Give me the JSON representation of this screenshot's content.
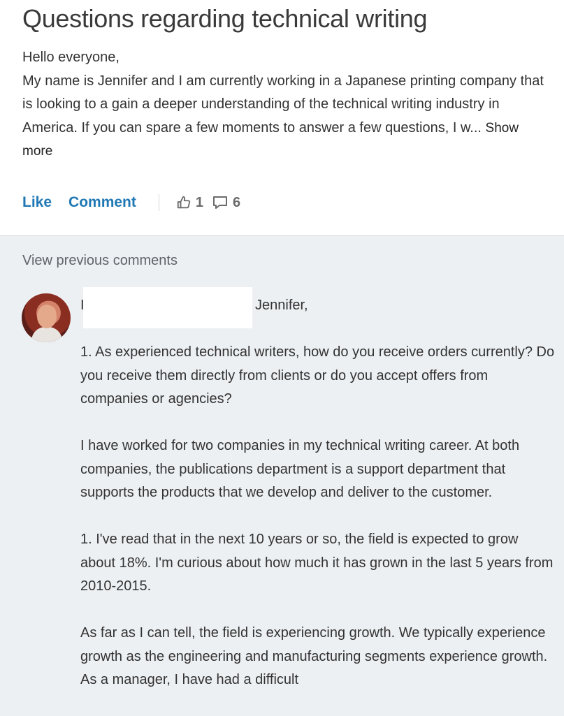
{
  "post": {
    "title": "Questions regarding technical writing",
    "greeting": "Hello everyone,",
    "body": "My name is Jennifer and I am currently working in a Japanese printing company that is looking to a gain a deeper understanding of the technical writing industry in America. If you can spare a few moments to answer a few questions, I w... ",
    "show_more": "Show more",
    "like_label": "Like",
    "comment_label": "Comment",
    "like_count": "1",
    "comment_count": "6",
    "icons": {
      "likes": "thumbs-up-icon",
      "comments": "speech-bubble-icon"
    },
    "accent_color": "#1f78b4"
  },
  "comments": {
    "view_previous": "View previous comments",
    "background_color": "#edf0f3",
    "items": [
      {
        "author_initial": "I",
        "salutation": "Jennifer,",
        "paragraphs": [
          "1. As experienced technical writers, how do you receive orders currently? Do you receive them directly from clients or do you accept offers from companies or agencies?",
          "I have worked for two companies in my technical writing career. At both companies, the publications department is a support department that supports the products that we develop and deliver to the customer.",
          "1. I've read that in the next 10 years or so, the field is expected to grow about 18%. I'm curious about how much it has grown in the last 5 years from 2010-2015.",
          "As far as I can tell, the field is experiencing growth. We typically experience growth as the engineering and manufacturing segments experience growth. As a manager, I have had a difficult"
        ]
      }
    ]
  }
}
